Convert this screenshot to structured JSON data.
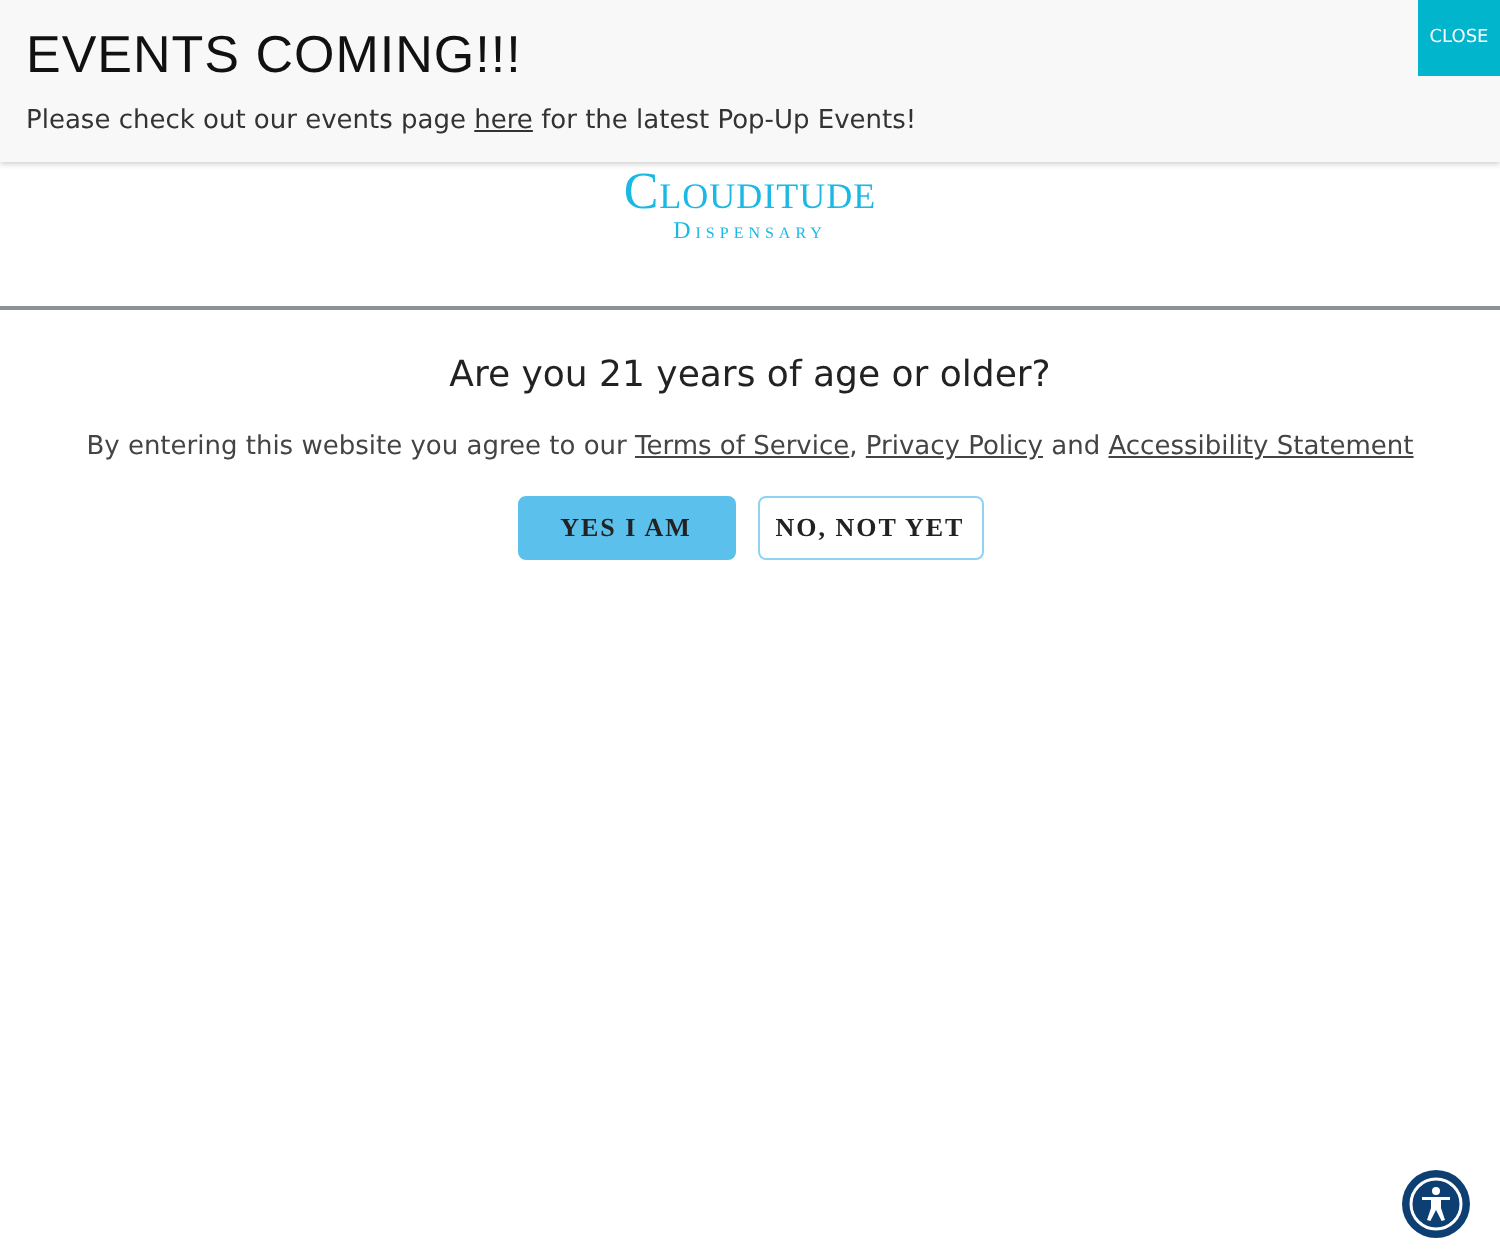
{
  "banner": {
    "title": "EVENTS COMING!!!",
    "message": [
      {
        "kind": "text",
        "text": "Please check out our events page "
      },
      {
        "kind": "link",
        "text": "here"
      },
      {
        "kind": "text",
        "text": " for the latest Pop-Up Events!"
      }
    ],
    "close_button": "CLOSE"
  },
  "logo": {
    "name": "Clouditude",
    "subtitle": "Dispensary"
  },
  "age_gate": {
    "question": "Are you 21 years of age or older?",
    "consent": [
      {
        "kind": "text",
        "text": "By entering this website you agree to our "
      },
      {
        "kind": "link",
        "text": "Terms of Service"
      },
      {
        "kind": "text",
        "text": ", "
      },
      {
        "kind": "link",
        "text": "Privacy Policy"
      },
      {
        "kind": "text",
        "text": " and "
      },
      {
        "kind": "link",
        "text": "Accessibility Statement"
      }
    ],
    "buttons": [
      {
        "label": "YES I AM",
        "kind": "primary"
      },
      {
        "label": "NO, NOT YET",
        "kind": "outline"
      }
    ]
  }
}
